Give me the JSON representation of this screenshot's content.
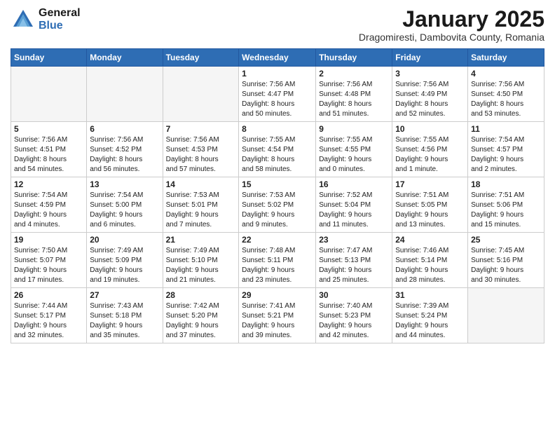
{
  "header": {
    "logo_general": "General",
    "logo_blue": "Blue",
    "month_title": "January 2025",
    "subtitle": "Dragomiresti, Dambovita County, Romania"
  },
  "weekdays": [
    "Sunday",
    "Monday",
    "Tuesday",
    "Wednesday",
    "Thursday",
    "Friday",
    "Saturday"
  ],
  "weeks": [
    [
      {
        "day": "",
        "info": ""
      },
      {
        "day": "",
        "info": ""
      },
      {
        "day": "",
        "info": ""
      },
      {
        "day": "1",
        "info": "Sunrise: 7:56 AM\nSunset: 4:47 PM\nDaylight: 8 hours\nand 50 minutes."
      },
      {
        "day": "2",
        "info": "Sunrise: 7:56 AM\nSunset: 4:48 PM\nDaylight: 8 hours\nand 51 minutes."
      },
      {
        "day": "3",
        "info": "Sunrise: 7:56 AM\nSunset: 4:49 PM\nDaylight: 8 hours\nand 52 minutes."
      },
      {
        "day": "4",
        "info": "Sunrise: 7:56 AM\nSunset: 4:50 PM\nDaylight: 8 hours\nand 53 minutes."
      }
    ],
    [
      {
        "day": "5",
        "info": "Sunrise: 7:56 AM\nSunset: 4:51 PM\nDaylight: 8 hours\nand 54 minutes."
      },
      {
        "day": "6",
        "info": "Sunrise: 7:56 AM\nSunset: 4:52 PM\nDaylight: 8 hours\nand 56 minutes."
      },
      {
        "day": "7",
        "info": "Sunrise: 7:56 AM\nSunset: 4:53 PM\nDaylight: 8 hours\nand 57 minutes."
      },
      {
        "day": "8",
        "info": "Sunrise: 7:55 AM\nSunset: 4:54 PM\nDaylight: 8 hours\nand 58 minutes."
      },
      {
        "day": "9",
        "info": "Sunrise: 7:55 AM\nSunset: 4:55 PM\nDaylight: 9 hours\nand 0 minutes."
      },
      {
        "day": "10",
        "info": "Sunrise: 7:55 AM\nSunset: 4:56 PM\nDaylight: 9 hours\nand 1 minute."
      },
      {
        "day": "11",
        "info": "Sunrise: 7:54 AM\nSunset: 4:57 PM\nDaylight: 9 hours\nand 2 minutes."
      }
    ],
    [
      {
        "day": "12",
        "info": "Sunrise: 7:54 AM\nSunset: 4:59 PM\nDaylight: 9 hours\nand 4 minutes."
      },
      {
        "day": "13",
        "info": "Sunrise: 7:54 AM\nSunset: 5:00 PM\nDaylight: 9 hours\nand 6 minutes."
      },
      {
        "day": "14",
        "info": "Sunrise: 7:53 AM\nSunset: 5:01 PM\nDaylight: 9 hours\nand 7 minutes."
      },
      {
        "day": "15",
        "info": "Sunrise: 7:53 AM\nSunset: 5:02 PM\nDaylight: 9 hours\nand 9 minutes."
      },
      {
        "day": "16",
        "info": "Sunrise: 7:52 AM\nSunset: 5:04 PM\nDaylight: 9 hours\nand 11 minutes."
      },
      {
        "day": "17",
        "info": "Sunrise: 7:51 AM\nSunset: 5:05 PM\nDaylight: 9 hours\nand 13 minutes."
      },
      {
        "day": "18",
        "info": "Sunrise: 7:51 AM\nSunset: 5:06 PM\nDaylight: 9 hours\nand 15 minutes."
      }
    ],
    [
      {
        "day": "19",
        "info": "Sunrise: 7:50 AM\nSunset: 5:07 PM\nDaylight: 9 hours\nand 17 minutes."
      },
      {
        "day": "20",
        "info": "Sunrise: 7:49 AM\nSunset: 5:09 PM\nDaylight: 9 hours\nand 19 minutes."
      },
      {
        "day": "21",
        "info": "Sunrise: 7:49 AM\nSunset: 5:10 PM\nDaylight: 9 hours\nand 21 minutes."
      },
      {
        "day": "22",
        "info": "Sunrise: 7:48 AM\nSunset: 5:11 PM\nDaylight: 9 hours\nand 23 minutes."
      },
      {
        "day": "23",
        "info": "Sunrise: 7:47 AM\nSunset: 5:13 PM\nDaylight: 9 hours\nand 25 minutes."
      },
      {
        "day": "24",
        "info": "Sunrise: 7:46 AM\nSunset: 5:14 PM\nDaylight: 9 hours\nand 28 minutes."
      },
      {
        "day": "25",
        "info": "Sunrise: 7:45 AM\nSunset: 5:16 PM\nDaylight: 9 hours\nand 30 minutes."
      }
    ],
    [
      {
        "day": "26",
        "info": "Sunrise: 7:44 AM\nSunset: 5:17 PM\nDaylight: 9 hours\nand 32 minutes."
      },
      {
        "day": "27",
        "info": "Sunrise: 7:43 AM\nSunset: 5:18 PM\nDaylight: 9 hours\nand 35 minutes."
      },
      {
        "day": "28",
        "info": "Sunrise: 7:42 AM\nSunset: 5:20 PM\nDaylight: 9 hours\nand 37 minutes."
      },
      {
        "day": "29",
        "info": "Sunrise: 7:41 AM\nSunset: 5:21 PM\nDaylight: 9 hours\nand 39 minutes."
      },
      {
        "day": "30",
        "info": "Sunrise: 7:40 AM\nSunset: 5:23 PM\nDaylight: 9 hours\nand 42 minutes."
      },
      {
        "day": "31",
        "info": "Sunrise: 7:39 AM\nSunset: 5:24 PM\nDaylight: 9 hours\nand 44 minutes."
      },
      {
        "day": "",
        "info": ""
      }
    ]
  ],
  "alt_rows": [
    1,
    3
  ]
}
